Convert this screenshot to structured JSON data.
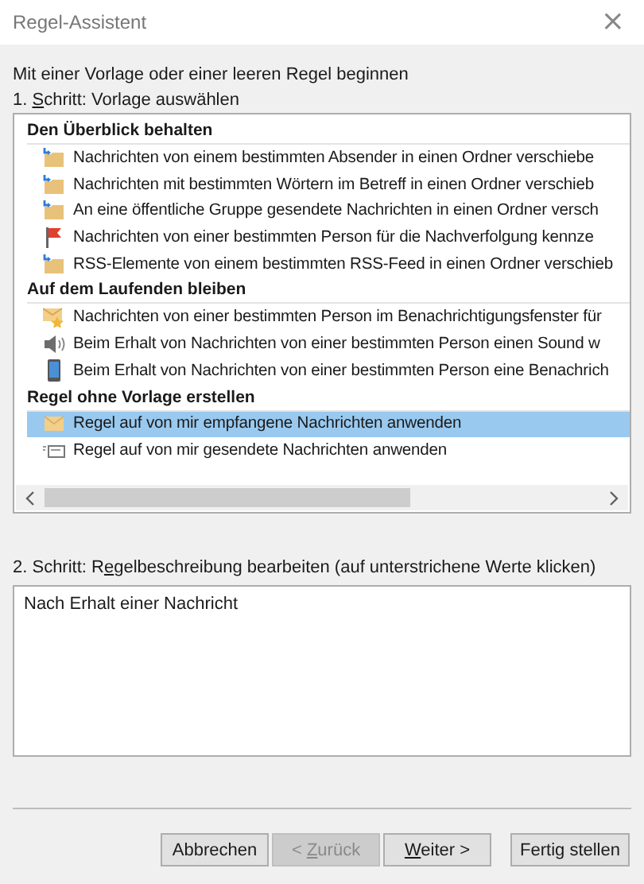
{
  "window": {
    "title": "Regel-Assistent",
    "close": "×"
  },
  "intro": "Mit einer Vorlage oder einer leeren Regel beginnen",
  "step1": {
    "before": "1. ",
    "key": "S",
    "after": "chritt: Vorlage auswählen"
  },
  "groups": [
    {
      "title": "Den Überblick behalten",
      "items": [
        {
          "kind": "move",
          "label": "Nachrichten von einem bestimmten Absender in einen Ordner verschiebe",
          "selected": false
        },
        {
          "kind": "move",
          "label": "Nachrichten mit bestimmten Wörtern im Betreff in einen Ordner verschieb",
          "selected": false
        },
        {
          "kind": "move",
          "label": "An eine öffentliche Gruppe gesendete Nachrichten in einen Ordner versch",
          "selected": false
        },
        {
          "kind": "flag",
          "label": "Nachrichten von einer bestimmten Person für die Nachverfolgung kennze",
          "selected": false
        },
        {
          "kind": "move",
          "label": "RSS-Elemente von einem bestimmten RSS-Feed in einen Ordner verschieb",
          "selected": false
        }
      ]
    },
    {
      "title": "Auf dem Laufenden bleiben",
      "items": [
        {
          "kind": "alert",
          "label": "Nachrichten von einer bestimmten Person im Benachrichtigungsfenster für",
          "selected": false
        },
        {
          "kind": "sound",
          "label": "Beim Erhalt von Nachrichten von einer bestimmten Person einen Sound w",
          "selected": false
        },
        {
          "kind": "mobile",
          "label": "Beim Erhalt von Nachrichten von einer bestimmten Person eine Benachrich",
          "selected": false
        }
      ]
    },
    {
      "title": "Regel ohne Vorlage erstellen",
      "items": [
        {
          "kind": "received",
          "label": "Regel auf von mir empfangene Nachrichten anwenden",
          "selected": true
        },
        {
          "kind": "sent",
          "label": "Regel auf von mir gesendete Nachrichten anwenden",
          "selected": false
        }
      ]
    }
  ],
  "step2": {
    "before": "2. Schritt: R",
    "key": "e",
    "after": "gelbeschreibung bearbeiten (auf unterstrichene Werte klicken)"
  },
  "description": "Nach Erhalt einer Nachricht",
  "buttons": [
    {
      "after": "Abbrechen",
      "disabled": false
    },
    {
      "before": "< ",
      "key": "Z",
      "after": "urück",
      "disabled": true
    },
    {
      "key": "W",
      "after": "eiter >",
      "disabled": false
    },
    {
      "after": "Fertig stellen",
      "disabled": false
    }
  ]
}
